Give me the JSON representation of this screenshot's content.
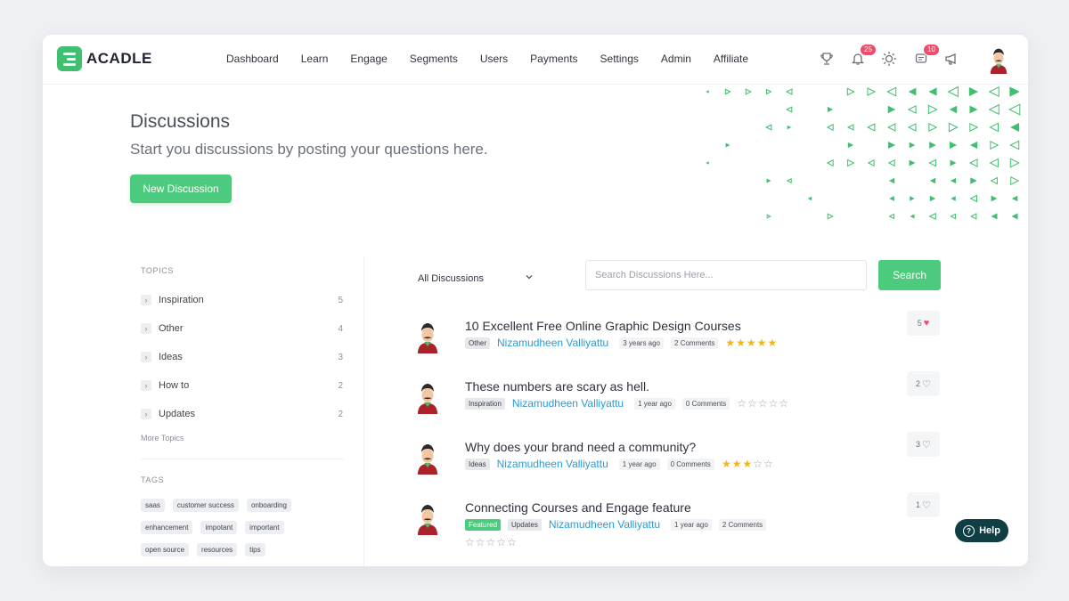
{
  "app": {
    "name": "ACADLE"
  },
  "nav": [
    "Dashboard",
    "Learn",
    "Engage",
    "Segments",
    "Users",
    "Payments",
    "Settings",
    "Admin",
    "Affiliate"
  ],
  "header_icons": {
    "notifications_count": "25",
    "messages_count": "10",
    "icons": [
      "trophy-icon",
      "bell-icon",
      "sun-icon",
      "message-icon",
      "megaphone-icon"
    ]
  },
  "hero": {
    "title": "Discussions",
    "subtitle": "Start you discussions by posting your questions here.",
    "new_button": "New Discussion"
  },
  "sidebar": {
    "topics_heading": "TOPICS",
    "topics": [
      {
        "label": "Inspiration",
        "count": "5"
      },
      {
        "label": "Other",
        "count": "4"
      },
      {
        "label": "Ideas",
        "count": "3"
      },
      {
        "label": "How to",
        "count": "2"
      },
      {
        "label": "Updates",
        "count": "2"
      }
    ],
    "more_topics": "More Topics",
    "tags_heading": "TAGS",
    "tags": [
      "saas",
      "customer success",
      "onboarding",
      "enhancement",
      "impotant",
      "important",
      "open source",
      "resources",
      "tips"
    ]
  },
  "filters": {
    "selected": "All Discussions",
    "search_placeholder": "Search Discussions Here...",
    "search_button": "Search"
  },
  "discussions": [
    {
      "title": "10 Excellent Free Online Graphic Design Courses",
      "chips": [
        "Other"
      ],
      "featured": false,
      "author": "Nizamudheen Valliyattu",
      "time": "3 years ago",
      "comments": "2 Comments",
      "rating": 4.5,
      "likes": "5",
      "liked": true
    },
    {
      "title": "These numbers are scary as hell.",
      "chips": [
        "Inspiration"
      ],
      "featured": false,
      "author": "Nizamudheen Valliyattu",
      "time": "1 year ago",
      "comments": "0 Comments",
      "rating": 0,
      "likes": "2",
      "liked": false
    },
    {
      "title": "Why does your brand need a community?",
      "chips": [
        "Ideas"
      ],
      "featured": false,
      "author": "Nizamudheen Valliyattu",
      "time": "1 year ago",
      "comments": "0 Comments",
      "rating": 3,
      "likes": "3",
      "liked": false
    },
    {
      "title": "Connecting Courses and Engage feature",
      "chips": [
        "Featured",
        "Updates"
      ],
      "featured": true,
      "author": "Nizamudheen Valliyattu",
      "time": "1 year ago",
      "comments": "2 Comments",
      "rating": 0,
      "likes": "1",
      "liked": false
    }
  ],
  "help_button": "Help",
  "colors": {
    "accent": "#4ccb7e",
    "link": "#2a9bd7",
    "badge": "#ee4d6b",
    "help": "#0f3f44"
  }
}
